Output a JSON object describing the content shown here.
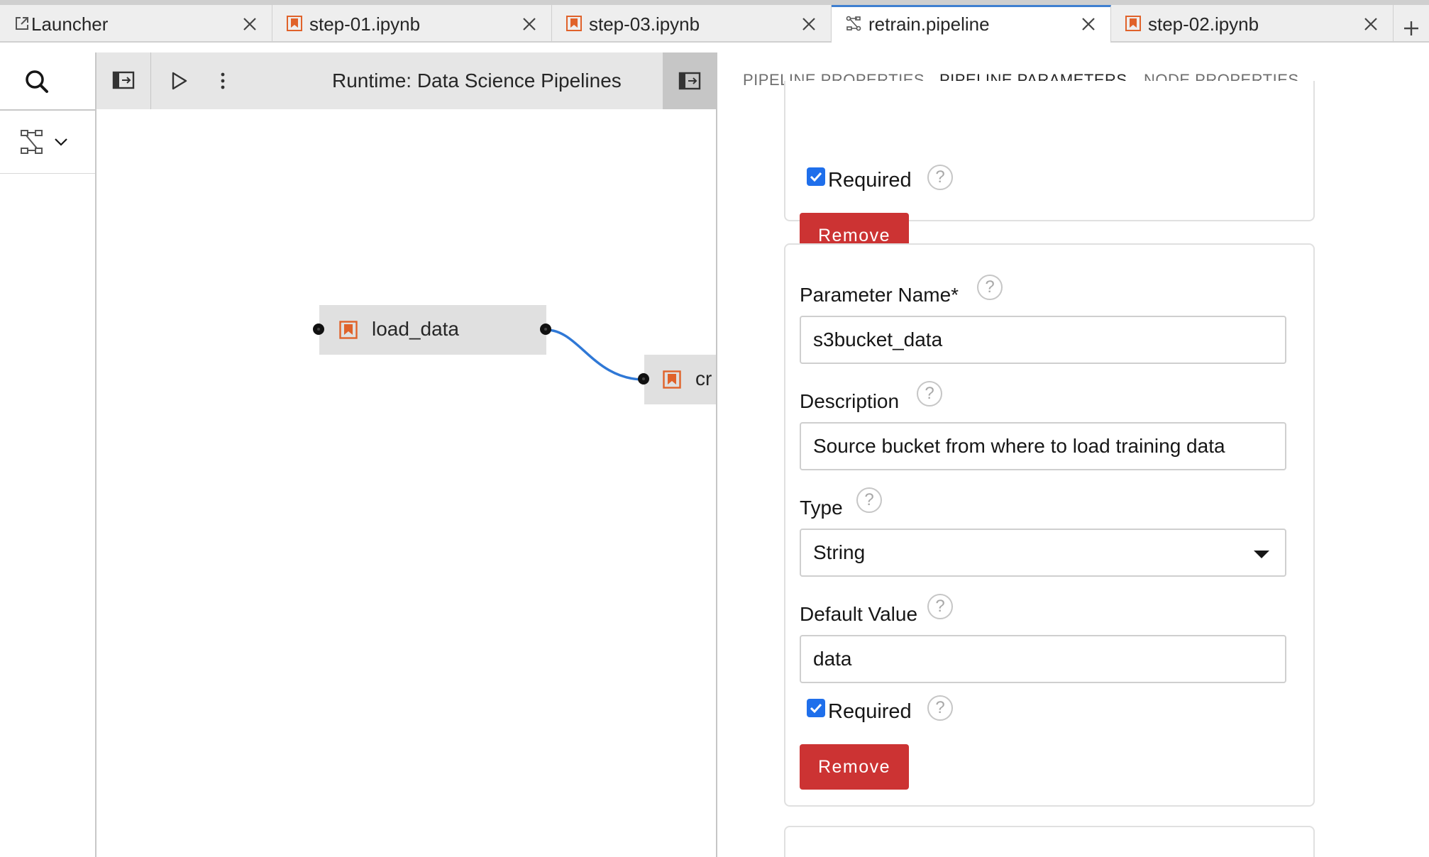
{
  "tabs": [
    {
      "label": "Launcher",
      "icon": "external-link-icon",
      "active": false
    },
    {
      "label": "step-01.ipynb",
      "icon": "notebook-icon",
      "active": false
    },
    {
      "label": "step-03.ipynb",
      "icon": "notebook-icon",
      "active": false
    },
    {
      "label": "retrain.pipeline",
      "icon": "pipeline-icon",
      "active": true
    },
    {
      "label": "step-02.ipynb",
      "icon": "notebook-icon",
      "active": false
    }
  ],
  "toolbar": {
    "runtime_label": "Runtime: Data Science Pipelines"
  },
  "canvas": {
    "nodes": [
      {
        "label": "load_data"
      },
      {
        "label": "cr"
      }
    ]
  },
  "panel": {
    "tabs": [
      {
        "label": "PIPELINE PROPERTIES",
        "active": false
      },
      {
        "label": "PIPELINE PARAMETERS",
        "active": true
      },
      {
        "label": "NODE PROPERTIES",
        "active": false
      }
    ],
    "help_glyph": "?",
    "card_prev": {
      "required_label": "Required",
      "required_checked": true,
      "remove_label": "Remove"
    },
    "card_param": {
      "name_label": "Parameter Name*",
      "name_value": "s3bucket_data",
      "description_label": "Description",
      "description_value": "Source bucket from where to load training data",
      "type_label": "Type",
      "type_value": "String",
      "default_label": "Default Value",
      "default_value": "data",
      "required_label": "Required",
      "required_checked": true,
      "remove_label": "Remove"
    }
  },
  "colors": {
    "accent": "#3f7fd0",
    "checkbox": "#1f6feb",
    "remove_button": "#cc3333",
    "notebook_icon": "#e0622a",
    "connector": "#2f78d6"
  }
}
